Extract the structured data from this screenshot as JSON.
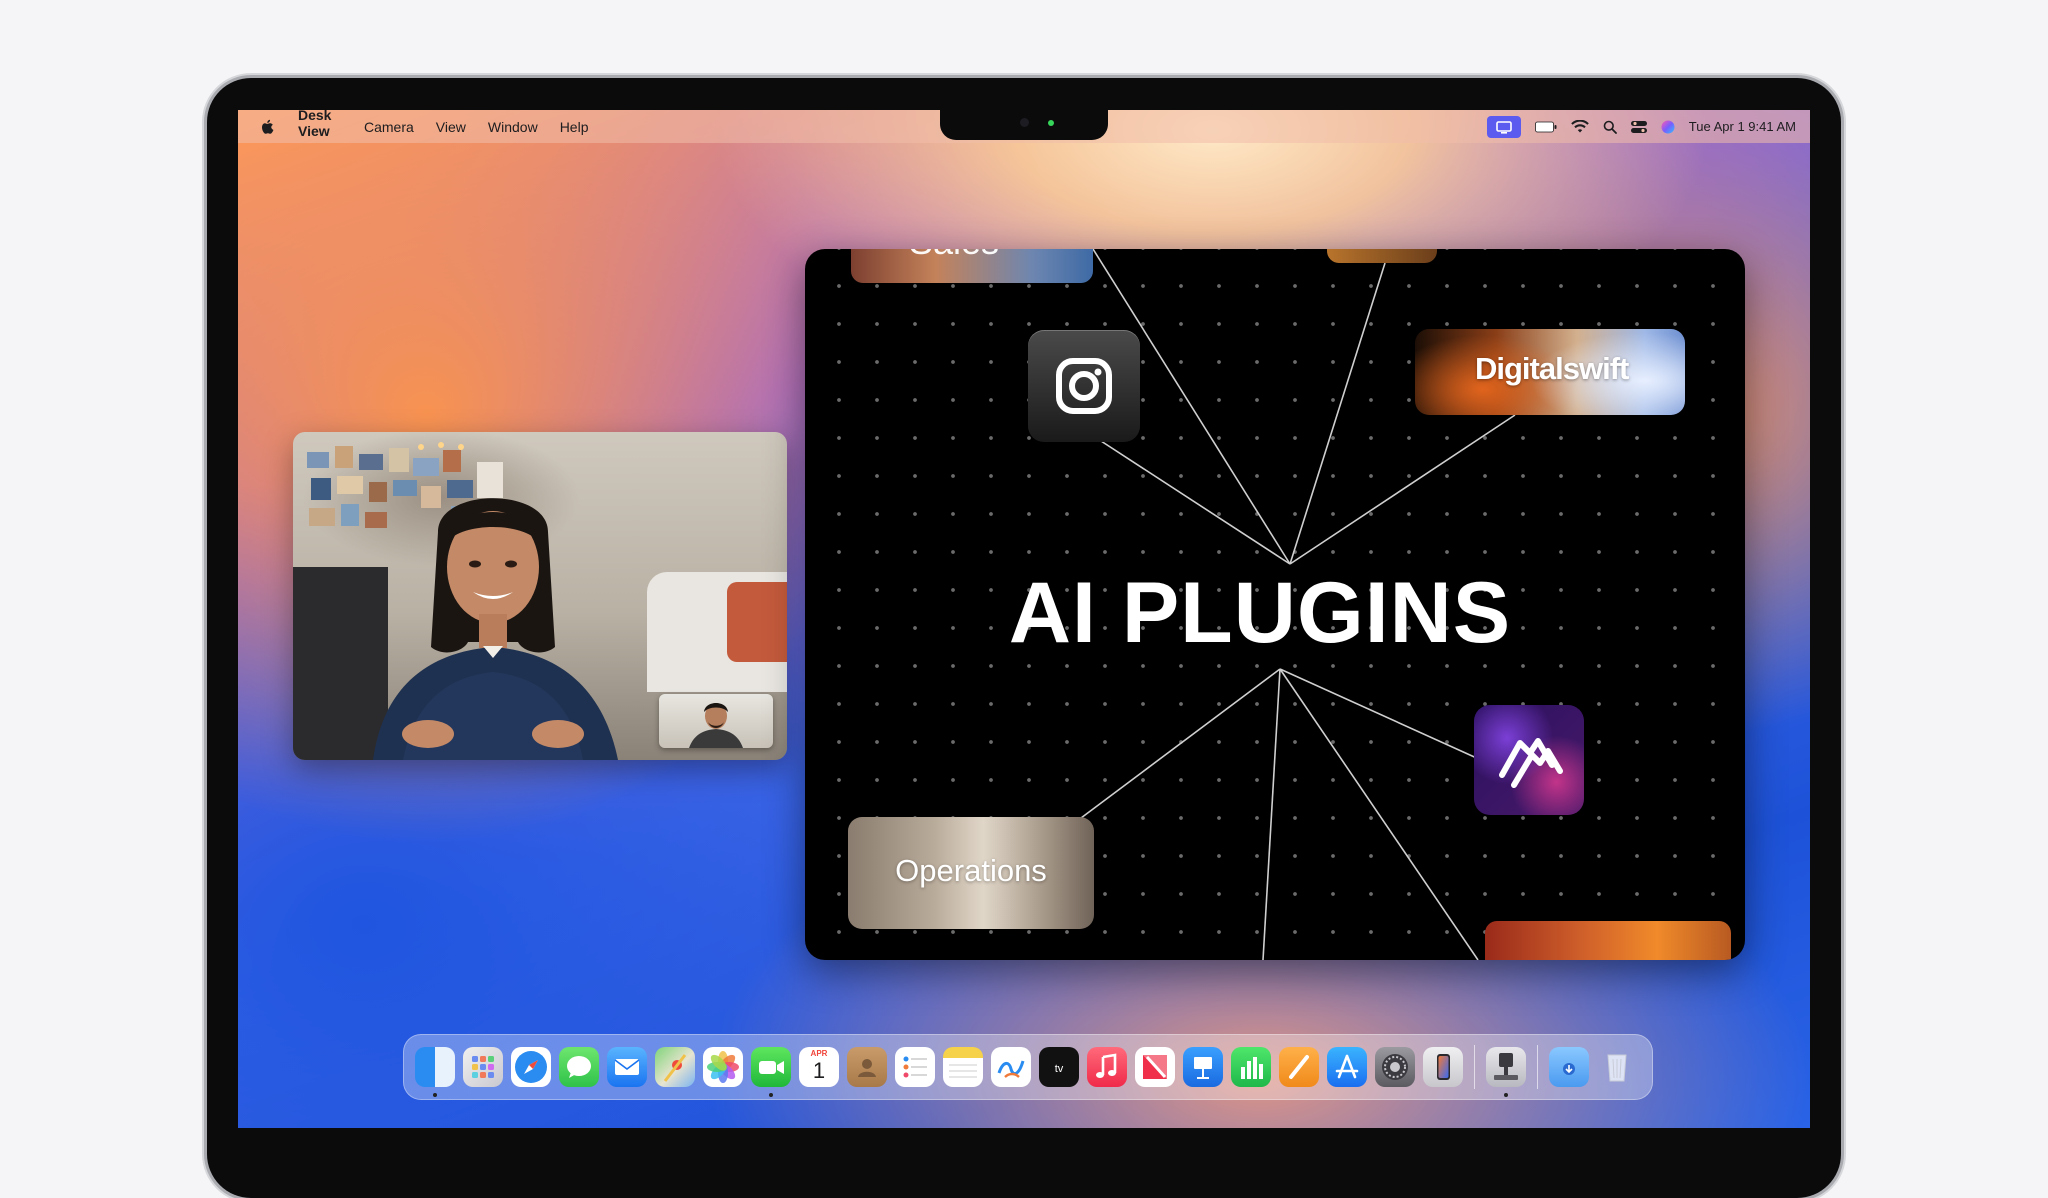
{
  "menubar": {
    "app_name": "Desk View",
    "menus": [
      "Camera",
      "View",
      "Window",
      "Help"
    ],
    "datetime": "Tue Apr 1  9:41 AM"
  },
  "ai_window": {
    "title": "AI PLUGINS",
    "cards": {
      "top_left_partial": "Sales",
      "digitalswift": "Digitalswift",
      "operations": "Operations"
    }
  },
  "dock": {
    "apps": [
      "Finder",
      "Launchpad",
      "Safari",
      "Messages",
      "Mail",
      "Maps",
      "Photos",
      "FaceTime",
      "Calendar",
      "Contacts",
      "Reminders",
      "Notes",
      "Freeform",
      "TV",
      "Music",
      "News",
      "Keynote",
      "Numbers",
      "Pages",
      "App Store",
      "System Settings",
      "iPhone Mirroring",
      "Desk View",
      "Downloads",
      "Trash"
    ],
    "calendar": {
      "month": "APR",
      "day": "1"
    }
  },
  "colors": {
    "menubar_bg": "#f0beaa",
    "window_bg": "#000000",
    "accent_blue": "#1d52d8",
    "accent_orange": "#ff9a5a"
  }
}
